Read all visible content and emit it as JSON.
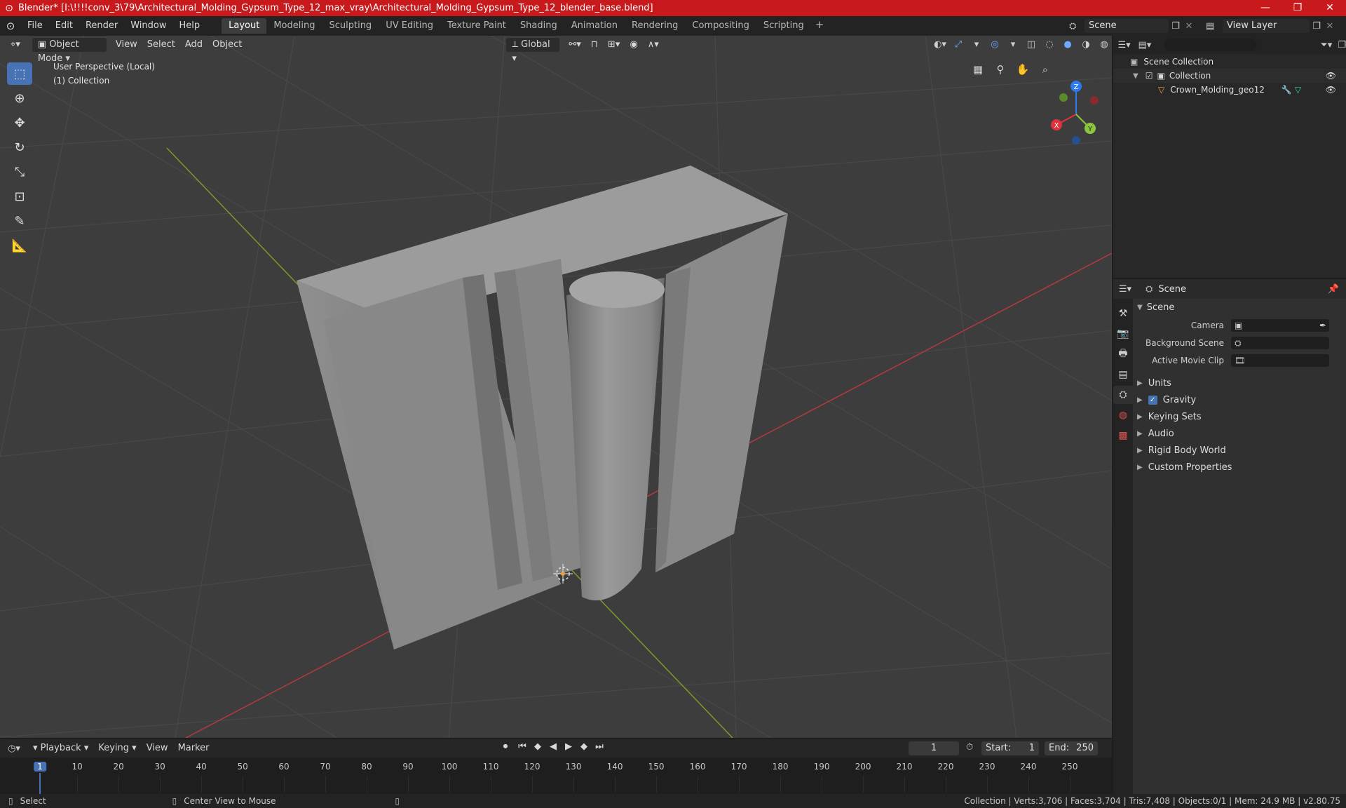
{
  "window": {
    "title": "Blender* [I:\\!!!!conv_3\\79\\Architectural_Molding_Gypsum_Type_12_max_vray\\Architectural_Molding_Gypsum_Type_12_blender_base.blend]",
    "minimize": "—",
    "maximize": "❐",
    "close": "✕"
  },
  "menu": [
    "File",
    "Edit",
    "Render",
    "Window",
    "Help"
  ],
  "workspaces": [
    "Layout",
    "Modeling",
    "Sculpting",
    "UV Editing",
    "Texture Paint",
    "Shading",
    "Animation",
    "Rendering",
    "Compositing",
    "Scripting"
  ],
  "workspace_add": "+",
  "scene_name": "Scene",
  "view_layer": "View Layer",
  "viewport": {
    "mode": "Object Mode",
    "menus": [
      "View",
      "Select",
      "Add",
      "Object"
    ],
    "transform_orientation": "Global",
    "info_line1": "User Perspective (Local)",
    "info_line2": "(1) Collection",
    "gizmo": {
      "x": "X",
      "y": "Y",
      "z": "Z"
    }
  },
  "outliner": {
    "search_placeholder": "",
    "scene_collection": "Scene Collection",
    "collection": "Collection",
    "object": "Crown_Molding_geo12"
  },
  "properties": {
    "context": "Scene",
    "panel_title": "Scene",
    "camera_label": "Camera",
    "background_scene_label": "Background Scene",
    "active_movie_clip_label": "Active Movie Clip",
    "sections": [
      "Units",
      "Gravity",
      "Keying Sets",
      "Audio",
      "Rigid Body World",
      "Custom Properties"
    ]
  },
  "timeline": {
    "menus": [
      "Playback",
      "Keying",
      "View",
      "Marker"
    ],
    "current_frame": "1",
    "start_label": "Start:",
    "start": "1",
    "end_label": "End:",
    "end": "250",
    "ticks": [
      "1",
      "10",
      "20",
      "30",
      "40",
      "50",
      "60",
      "70",
      "80",
      "90",
      "100",
      "110",
      "120",
      "130",
      "140",
      "150",
      "160",
      "170",
      "180",
      "190",
      "200",
      "210",
      "220",
      "230",
      "240",
      "250"
    ]
  },
  "status": {
    "select": "Select",
    "center_view": "Center View to Mouse",
    "stats": "Collection | Verts:3,706 | Faces:3,704 | Tris:7,408 | Objects:0/1 | Mem: 24.9 MB | v2.80.75"
  },
  "colors": {
    "titlebar": "#c8191c",
    "accent": "#4772b3",
    "axis_x": "#e0323c",
    "axis_y": "#8cc63f",
    "axis_z": "#2d7bf0"
  }
}
